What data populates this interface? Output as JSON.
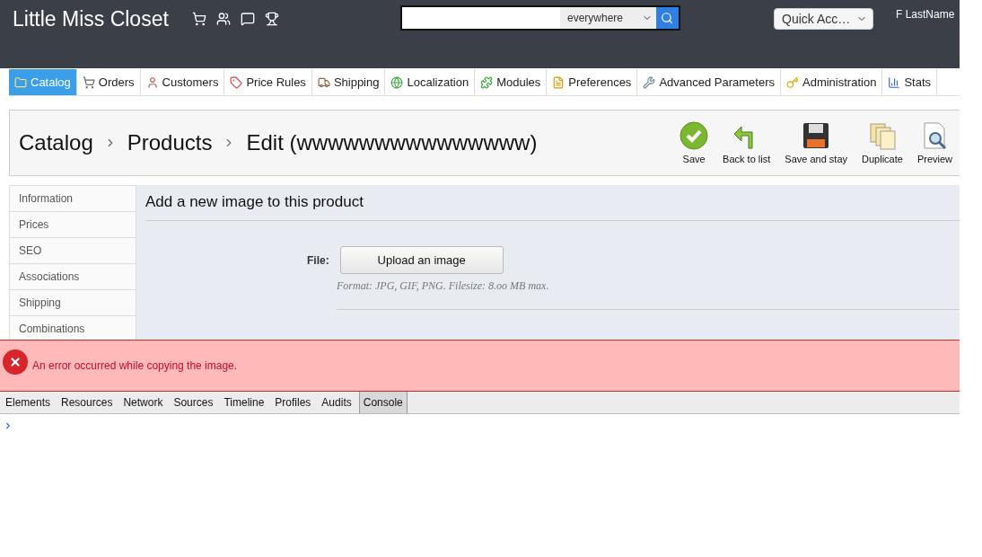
{
  "header": {
    "shop_name": "Little Miss Closet",
    "search": {
      "scope": "everywhere"
    },
    "quick_access": "Quick Acc…",
    "user": "F LastName"
  },
  "tabs": [
    {
      "label": "Catalog",
      "selected": true
    },
    {
      "label": "Orders",
      "selected": false
    },
    {
      "label": "Customers",
      "selected": false
    },
    {
      "label": "Price Rules",
      "selected": false
    },
    {
      "label": "Shipping",
      "selected": false
    },
    {
      "label": "Localization",
      "selected": false
    },
    {
      "label": "Modules",
      "selected": false
    },
    {
      "label": "Preferences",
      "selected": false
    },
    {
      "label": "Advanced Parameters",
      "selected": false
    },
    {
      "label": "Administration",
      "selected": false
    },
    {
      "label": "Stats",
      "selected": false
    }
  ],
  "breadcrumb": [
    "Catalog",
    "Products",
    "Edit (wwwwwwwwwwwwwww)"
  ],
  "toolbar": [
    {
      "kind": "save",
      "label": "Save"
    },
    {
      "kind": "back",
      "label": "Back to list"
    },
    {
      "kind": "savestay",
      "label": "Save and stay"
    },
    {
      "kind": "duplicate",
      "label": "Duplicate"
    },
    {
      "kind": "preview",
      "label": "Preview"
    }
  ],
  "sidebar": [
    {
      "label": "Information",
      "selected": false
    },
    {
      "label": "Prices",
      "selected": false
    },
    {
      "label": "SEO",
      "selected": false
    },
    {
      "label": "Associations",
      "selected": false
    },
    {
      "label": "Shipping",
      "selected": false
    },
    {
      "label": "Combinations",
      "selected": false
    }
  ],
  "panel": {
    "title": "Add a new image to this product",
    "file_label": "File:",
    "upload_button": "Upload an image",
    "hint": "Format: JPG, GIF, PNG. Filesize: 8.oo MB max."
  },
  "error": "An error occurred while copying the image.",
  "devtools": {
    "tabs": [
      {
        "label": "Elements",
        "selected": false
      },
      {
        "label": "Resources",
        "selected": false
      },
      {
        "label": "Network",
        "selected": false
      },
      {
        "label": "Sources",
        "selected": false
      },
      {
        "label": "Timeline",
        "selected": false
      },
      {
        "label": "Profiles",
        "selected": false
      },
      {
        "label": "Audits",
        "selected": false
      },
      {
        "label": "Console",
        "selected": true
      }
    ]
  }
}
